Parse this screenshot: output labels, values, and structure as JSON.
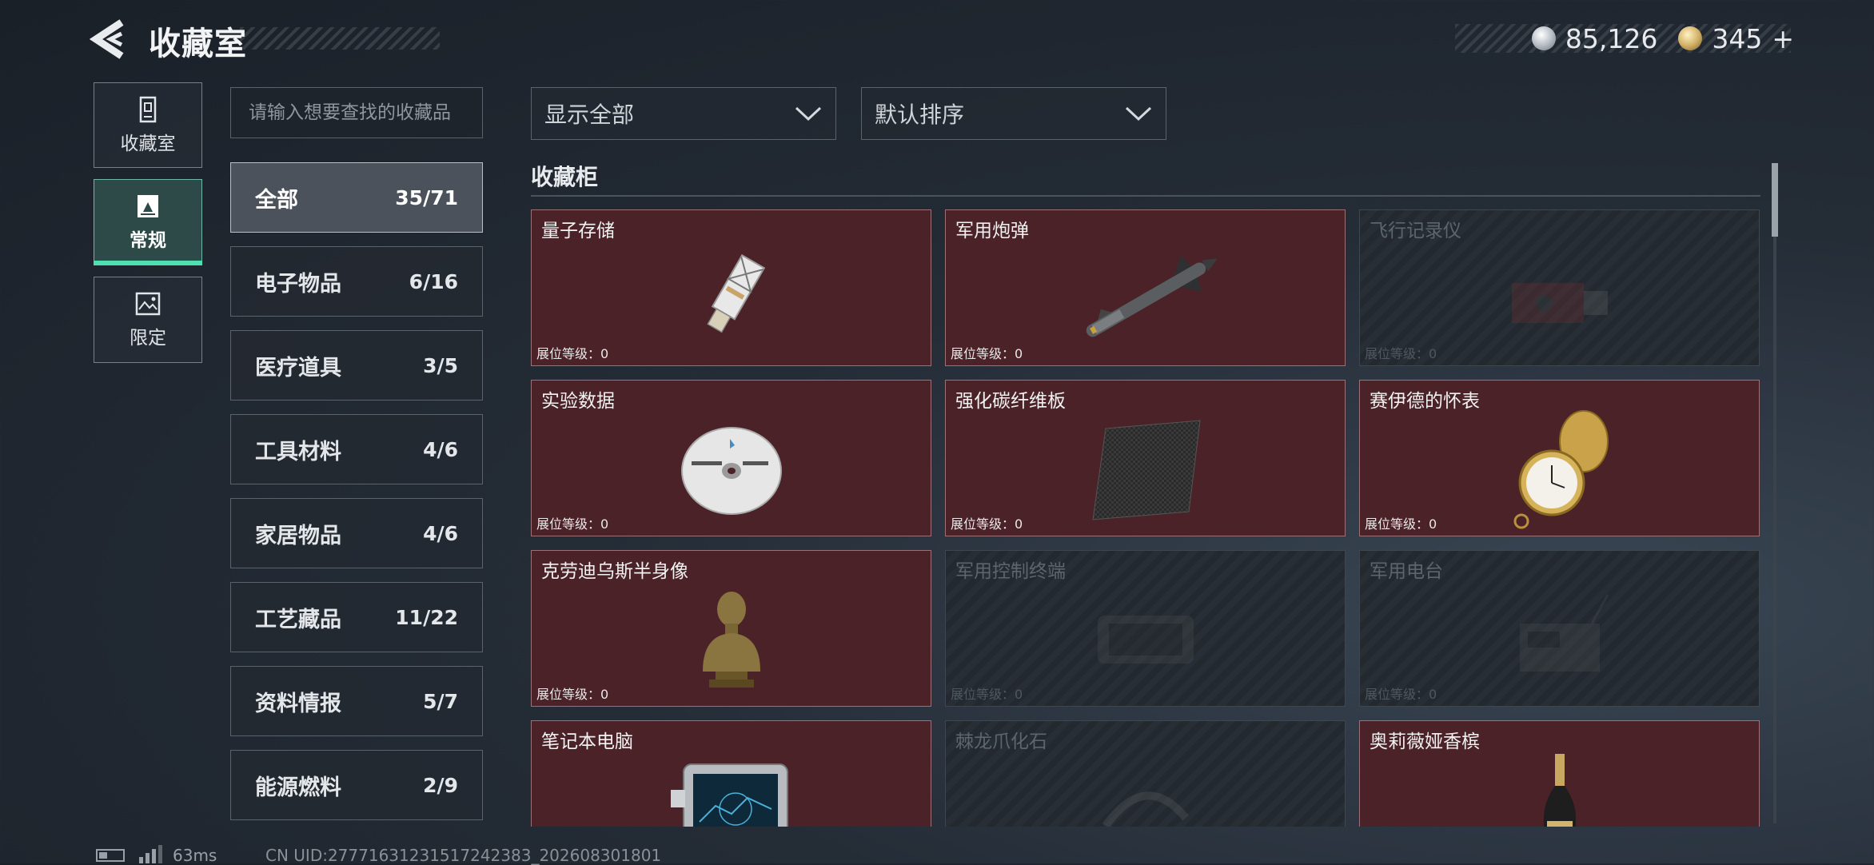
{
  "header": {
    "title": "收藏室",
    "currency": [
      {
        "icon": "silver-coin-icon",
        "value": "85,126"
      },
      {
        "icon": "gold-coin-icon",
        "value": "345"
      }
    ],
    "add_symbol": "+"
  },
  "left_nav": [
    {
      "label": "收藏室",
      "icon": "collection-room-icon",
      "active": false
    },
    {
      "label": "常规",
      "icon": "regular-icon",
      "active": true
    },
    {
      "label": "限定",
      "icon": "limited-icon",
      "active": false
    }
  ],
  "search": {
    "placeholder": "请输入想要查找的收藏品",
    "value": ""
  },
  "filters": {
    "display": "显示全部",
    "sort": "默认排序"
  },
  "categories": [
    {
      "name": "全部",
      "count": "35/71",
      "active": true
    },
    {
      "name": "电子物品",
      "count": "6/16"
    },
    {
      "name": "医疗道具",
      "count": "3/5"
    },
    {
      "name": "工具材料",
      "count": "4/6"
    },
    {
      "name": "家居物品",
      "count": "4/6"
    },
    {
      "name": "工艺藏品",
      "count": "11/22"
    },
    {
      "name": "资料情报",
      "count": "5/7"
    },
    {
      "name": "能源燃料",
      "count": "2/9"
    }
  ],
  "cabinet": {
    "title": "收藏柜",
    "items": [
      {
        "name": "量子存储",
        "level_label": "展位等级：",
        "level": "0",
        "owned": true,
        "art": "usb-drive"
      },
      {
        "name": "军用炮弹",
        "level_label": "展位等级：",
        "level": "0",
        "owned": true,
        "art": "missile"
      },
      {
        "name": "飞行记录仪",
        "level_label": "展位等级：",
        "level": "0",
        "owned": false,
        "art": "recorder"
      },
      {
        "name": "实验数据",
        "level_label": "展位等级：",
        "level": "0",
        "owned": true,
        "art": "disc"
      },
      {
        "name": "强化碳纤维板",
        "level_label": "展位等级：",
        "level": "0",
        "owned": true,
        "art": "carbon-plate"
      },
      {
        "name": "赛伊德的怀表",
        "level_label": "展位等级：",
        "level": "0",
        "owned": true,
        "art": "pocket-watch"
      },
      {
        "name": "克劳迪乌斯半身像",
        "level_label": "展位等级：",
        "level": "0",
        "owned": true,
        "art": "bust"
      },
      {
        "name": "军用控制终端",
        "level_label": "展位等级：",
        "level": "0",
        "owned": false,
        "art": "terminal"
      },
      {
        "name": "军用电台",
        "level_label": "展位等级：",
        "level": "0",
        "owned": false,
        "art": "radio"
      },
      {
        "name": "笔记本电脑",
        "level_label": "",
        "level": "",
        "owned": true,
        "art": "laptop"
      },
      {
        "name": "棘龙爪化石",
        "level_label": "",
        "level": "",
        "owned": false,
        "art": "fossil"
      },
      {
        "name": "奥莉薇娅香槟",
        "level_label": "",
        "level": "",
        "owned": true,
        "art": "champagne"
      }
    ]
  },
  "footer": {
    "ping": "63ms",
    "uid": "CN UID:27771631231517242383_202608301801"
  },
  "colors": {
    "owned_card": "#4a2228",
    "accent": "#4fe0b0",
    "active_nav": "#2e4a48"
  }
}
